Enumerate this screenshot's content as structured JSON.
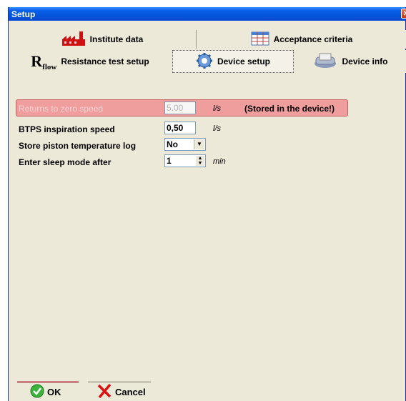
{
  "window": {
    "title": "Setup",
    "close_label": "✕"
  },
  "tabs_top": [
    {
      "label": "Institute data",
      "icon": "factory-icon"
    },
    {
      "label": "Acceptance criteria",
      "icon": "table-icon"
    }
  ],
  "tabs_bottom": [
    {
      "label": "Resistance  test setup",
      "icon": "rflow-icon",
      "icon_text_main": "R",
      "icon_text_sub": "flow"
    },
    {
      "label": "Device setup",
      "icon": "gear-icon",
      "selected": true
    },
    {
      "label": "Device info",
      "icon": "printer-icon"
    }
  ],
  "settings": {
    "return_speed": {
      "label": "Returns to zero speed",
      "value": "5.00",
      "unit": "l/s",
      "note": "(Stored in the device!)"
    },
    "btps_speed": {
      "label": "BTPS inspiration speed",
      "value": "0,50",
      "unit": "l/s"
    },
    "piston_log": {
      "label": "Store piston temperature log",
      "value": "No"
    },
    "sleep_mode": {
      "label": "Enter sleep mode after",
      "value": "1",
      "unit": "min"
    }
  },
  "buttons": {
    "ok": "OK",
    "cancel": "Cancel"
  },
  "colors": {
    "highlight": "#ef9d9d",
    "titlebar": "#0453d9"
  }
}
